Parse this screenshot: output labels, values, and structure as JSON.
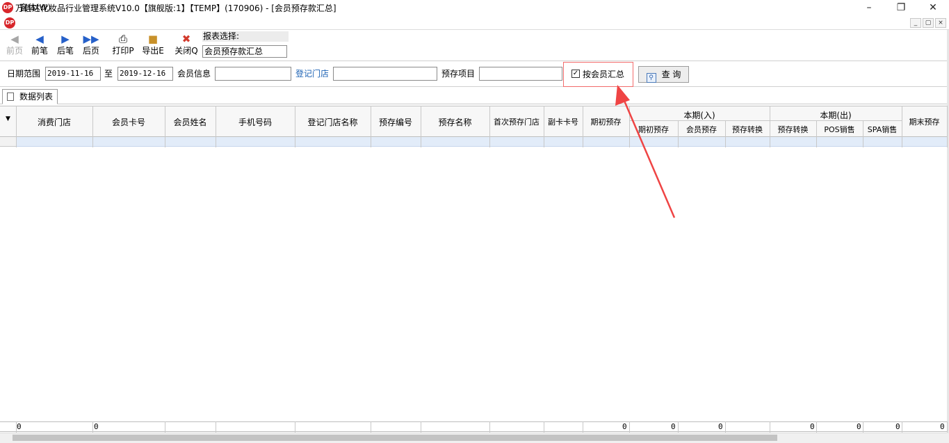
{
  "window": {
    "title": "万信达化妆品行业管理系统V10.0【旗舰版:1】【TEMP】(170906) - [会员预存款汇总]",
    "logo_text": "DP",
    "minimize_icon": "minimize-icon",
    "restore_icon": "restore-icon",
    "close_icon": "close-icon"
  },
  "menubar": {
    "label": "窗体(W)"
  },
  "toolbar": {
    "first_page": "前页",
    "prev_record": "前笔",
    "next_record": "后笔",
    "last_page": "后页",
    "print": "打印P",
    "export": "导出E",
    "close": "关闭Q",
    "report_select_label": "报表选择:",
    "report_select_value": "会员预存款汇总"
  },
  "filters": {
    "date_range_label": "日期范围",
    "date_from": "2019-11-16",
    "to_label": "至",
    "date_to": "2019-12-16",
    "member_info_label": "会员信息",
    "member_info_value": "",
    "register_store_label": "登记门店",
    "register_store_value": "",
    "deposit_item_label": "预存项目",
    "deposit_item_value": "",
    "group_by_member_label": "按会员汇总",
    "group_by_member_checked": true,
    "query_button": "查  询"
  },
  "tabs": [
    {
      "label": "数据列表"
    }
  ],
  "grid": {
    "columns": [
      "消费门店",
      "会员卡号",
      "会员姓名",
      "手机号码",
      "登记门店名称",
      "预存编号",
      "预存名称",
      "首次预存门店",
      "副卡卡号",
      "期初预存"
    ],
    "group_in": {
      "label": "本期(入)",
      "columns": [
        "期初预存",
        "会员预存",
        "预存转换"
      ]
    },
    "group_out": {
      "label": "本期(出)",
      "columns": [
        "预存转换",
        "POS销售",
        "SPA销售"
      ]
    },
    "last_column": "期末预存",
    "footer": [
      "0",
      "0",
      "0",
      "0",
      "0",
      "0",
      "0",
      "0",
      "0"
    ]
  },
  "colors": {
    "accent": "#1f64b5",
    "highlight_box": "#f26b6b",
    "arrow": "#ef4444"
  }
}
